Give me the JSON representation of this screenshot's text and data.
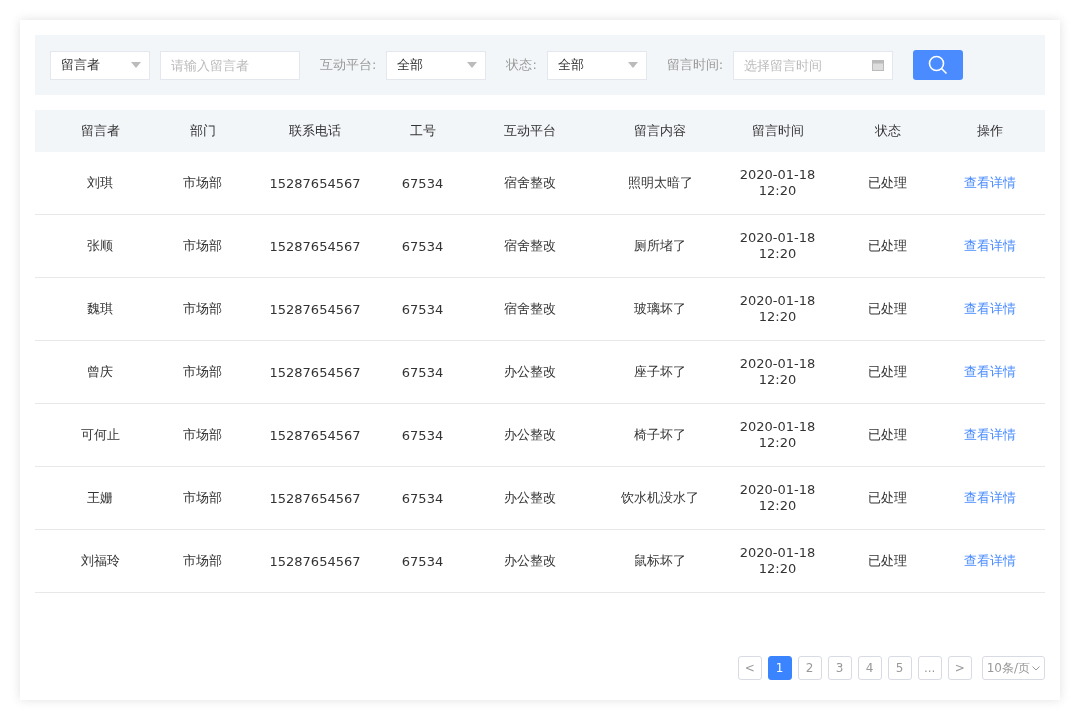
{
  "filters": [
    {
      "kind": "select",
      "value": "留言者"
    },
    {
      "kind": "input",
      "placeholder": "请输入留言者"
    },
    {
      "kind": "select",
      "label": "互动平台:",
      "value": "全部"
    },
    {
      "kind": "select",
      "label": "状态:",
      "value": "全部"
    },
    {
      "kind": "date",
      "label": "留言时间:",
      "placeholder": "选择留言时间"
    }
  ],
  "table": {
    "columns": [
      "留言者",
      "部门",
      "联系电话",
      "工号",
      "互动平台",
      "留言内容",
      "留言时间",
      "状态",
      "操作"
    ],
    "rows": [
      [
        "刘琪",
        "市场部",
        "15287654567",
        "67534",
        "宿舍整改",
        "照明太暗了",
        "2020-01-18 12:20",
        "已处理",
        "查看详情"
      ],
      [
        "张顺",
        "市场部",
        "15287654567",
        "67534",
        "宿舍整改",
        "厕所堵了",
        "2020-01-18 12:20",
        "已处理",
        "查看详情"
      ],
      [
        "魏琪",
        "市场部",
        "15287654567",
        "67534",
        "宿舍整改",
        "玻璃坏了",
        "2020-01-18 12:20",
        "已处理",
        "查看详情"
      ],
      [
        "曾庆",
        "市场部",
        "15287654567",
        "67534",
        "办公整改",
        "座子坏了",
        "2020-01-18 12:20",
        "已处理",
        "查看详情"
      ],
      [
        "可何止",
        "市场部",
        "15287654567",
        "67534",
        "办公整改",
        "椅子坏了",
        "2020-01-18 12:20",
        "已处理",
        "查看详情"
      ],
      [
        "王姗",
        "市场部",
        "15287654567",
        "67534",
        "办公整改",
        "饮水机没水了",
        "2020-01-18 12:20",
        "已处理",
        "查看详情"
      ],
      [
        "刘福玲",
        "市场部",
        "15287654567",
        "67534",
        "办公整改",
        "鼠标坏了",
        "2020-01-18 12:20",
        "已处理",
        "查看详情"
      ]
    ]
  },
  "pagination": {
    "prev": "<",
    "pages": [
      {
        "label": "1",
        "selected": true
      },
      {
        "label": "2",
        "selected": false
      },
      {
        "label": "3",
        "selected": false
      },
      {
        "label": "4",
        "selected": false
      },
      {
        "label": "5",
        "selected": false
      },
      {
        "label": "...",
        "selected": false
      }
    ],
    "next": ">",
    "page_size": "10条/页"
  }
}
